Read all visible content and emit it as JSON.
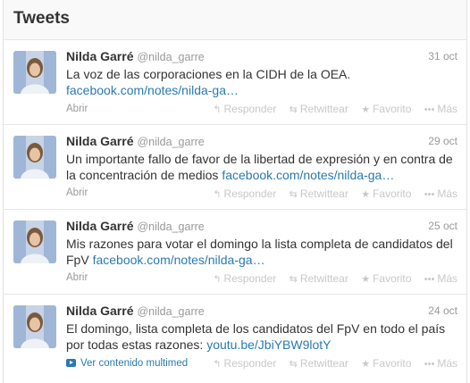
{
  "panel": {
    "title": "Tweets"
  },
  "tweets": [
    {
      "name": "Nilda Garré",
      "handle": "@nilda_garre",
      "time": "31 oct",
      "text": "La voz de las corporaciones en la CIDH de la OEA.",
      "link": "facebook.com/notes/nilda-ga…",
      "expand": "Abrir"
    },
    {
      "name": "Nilda Garré",
      "handle": "@nilda_garre",
      "time": "29 oct",
      "text": "Un importante fallo de favor de la libertad de expresión y en contra de la concentración de medios",
      "link": "facebook.com/notes/nilda-ga…",
      "expand": "Abrir"
    },
    {
      "name": "Nilda Garré",
      "handle": "@nilda_garre",
      "time": "25 oct",
      "text": "Mis razones para votar el domingo la lista completa de candidatos del FpV",
      "link": "facebook.com/notes/nilda-ga…",
      "expand": "Abrir"
    },
    {
      "name": "Nilda Garré",
      "handle": "@nilda_garre",
      "time": "24 oct",
      "text": "El domingo, lista completa de los candidatos del FpV en todo el país por todas estas razones:",
      "link": "youtu.be/JbiYBW9lotY",
      "expand": "Ver contenido multimed"
    }
  ],
  "actions": {
    "reply": "Responder",
    "retweet": "Retwittear",
    "favorite": "Favorito",
    "more": "Más"
  },
  "icons": {
    "reply": "reply-icon",
    "retweet": "retweet-icon",
    "favorite": "star-icon",
    "more": "more-dots-icon",
    "media": "media-play-icon"
  },
  "colors": {
    "link": "#2a7ab0",
    "muted": "#999999",
    "action": "#c8c8c8",
    "border": "#e6e6e6"
  }
}
